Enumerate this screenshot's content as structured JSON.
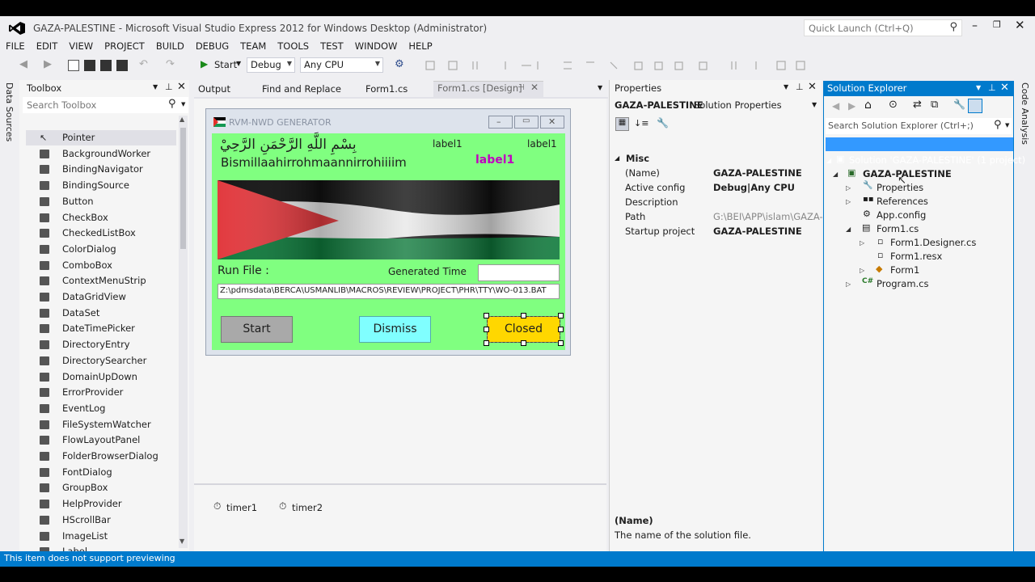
{
  "window": {
    "title": "GAZA-PALESTINE - Microsoft Visual Studio Express 2012 for Windows Desktop (Administrator)",
    "quick_launch_placeholder": "Quick Launch (Ctrl+Q)"
  },
  "menu": [
    "FILE",
    "EDIT",
    "VIEW",
    "PROJECT",
    "BUILD",
    "DEBUG",
    "TEAM",
    "TOOLS",
    "TEST",
    "WINDOW",
    "HELP"
  ],
  "toolbar": {
    "start_label": "Start",
    "config": "Debug",
    "platform": "Any CPU"
  },
  "left_strip": "Data Sources",
  "right_strip": "Code Analysis",
  "toolbox": {
    "title": "Toolbox",
    "search_placeholder": "Search Toolbox",
    "items": [
      "Pointer",
      "BackgroundWorker",
      "BindingNavigator",
      "BindingSource",
      "Button",
      "CheckBox",
      "CheckedListBox",
      "ColorDialog",
      "ComboBox",
      "ContextMenuStrip",
      "DataGridView",
      "DataSet",
      "DateTimePicker",
      "DirectoryEntry",
      "DirectorySearcher",
      "DomainUpDown",
      "ErrorProvider",
      "EventLog",
      "FileSystemWatcher",
      "FlowLayoutPanel",
      "FolderBrowserDialog",
      "FontDialog",
      "GroupBox",
      "HelpProvider",
      "HScrollBar",
      "ImageList",
      "Label"
    ]
  },
  "doc_tabs": [
    "Output",
    "Find and Replace",
    "Form1.cs",
    "Form1.cs [Design]"
  ],
  "form": {
    "title": "RVM-NWD GENERATOR",
    "arabic": "بِسْمِ اللَّهِ الرَّحْمَنِ الرَّحِيْ",
    "bismillah": "Bismillaahirrohmaannirrohiiiim",
    "label1a": "label1",
    "label1b": "label1",
    "label1c": "label1",
    "run_file": "Run File :",
    "generated_time": "Generated Time",
    "path": "Z:\\pdmsdata\\BERCA\\USMANLIB\\MACROS\\REVIEW\\PROJECT\\PHR\\TTY\\WO-013.BAT",
    "start": "Start",
    "dismiss": "Dismiss",
    "closed": "Closed"
  },
  "tray": [
    "timer1",
    "timer2"
  ],
  "properties": {
    "title": "Properties",
    "object": "GAZA-PALESTINE",
    "object_type": "Solution Properties",
    "category": "Misc",
    "rows": [
      {
        "name": "(Name)",
        "value": "GAZA-PALESTINE"
      },
      {
        "name": "Active config",
        "value": "Debug|Any CPU"
      },
      {
        "name": "Description",
        "value": ""
      },
      {
        "name": "Path",
        "value": "G:\\BEI\\APP\\islam\\GAZA-I"
      },
      {
        "name": "Startup project",
        "value": "GAZA-PALESTINE"
      }
    ],
    "desc_title": "(Name)",
    "desc_text": "The name of the solution file."
  },
  "solution_explorer": {
    "title": "Solution Explorer",
    "search_placeholder": "Search Solution Explorer (Ctrl+;)",
    "solution": "Solution 'GAZA-PALESTINE' (1 project)",
    "project": "GAZA-PALESTINE",
    "properties": "Properties",
    "references": "References",
    "app_config": "App.config",
    "form1_cs": "Form1.cs",
    "form1_designer": "Form1.Designer.cs",
    "form1_resx": "Form1.resx",
    "form1": "Form1",
    "program": "Program.cs"
  },
  "status": "This item does not support previewing",
  "colors": {
    "accent": "#007acc",
    "form_bg": "#80ff80",
    "closed_btn": "#ffd700",
    "dismiss_btn": "#80ffff",
    "start_btn": "#a9a9a9",
    "label_magenta": "#c000c0"
  }
}
